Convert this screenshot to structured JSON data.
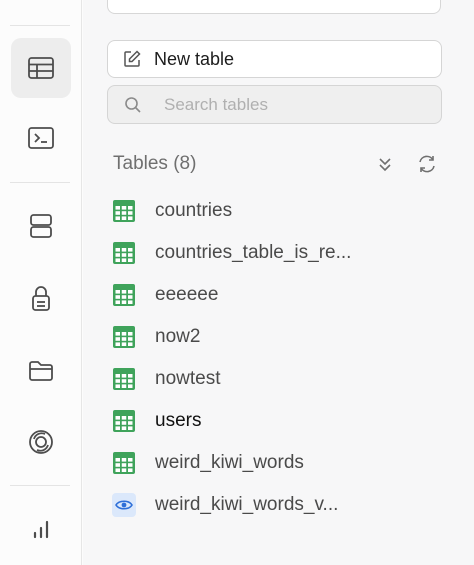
{
  "panel": {
    "new_table_label": "New table",
    "search_placeholder": "Search tables",
    "section_title": "Tables (8)"
  },
  "tables": [
    {
      "name": "countries",
      "kind": "table"
    },
    {
      "name": "countries_table_is_re...",
      "kind": "table"
    },
    {
      "name": "eeeeee",
      "kind": "table"
    },
    {
      "name": "now2",
      "kind": "table"
    },
    {
      "name": "nowtest",
      "kind": "table"
    },
    {
      "name": "users",
      "kind": "table"
    },
    {
      "name": "weird_kiwi_words",
      "kind": "table"
    },
    {
      "name": "weird_kiwi_words_v...",
      "kind": "view"
    }
  ],
  "colors": {
    "table_icon": "#3fa35b",
    "view_icon_bg": "#dbe8fb",
    "view_icon": "#2e6fd8"
  }
}
